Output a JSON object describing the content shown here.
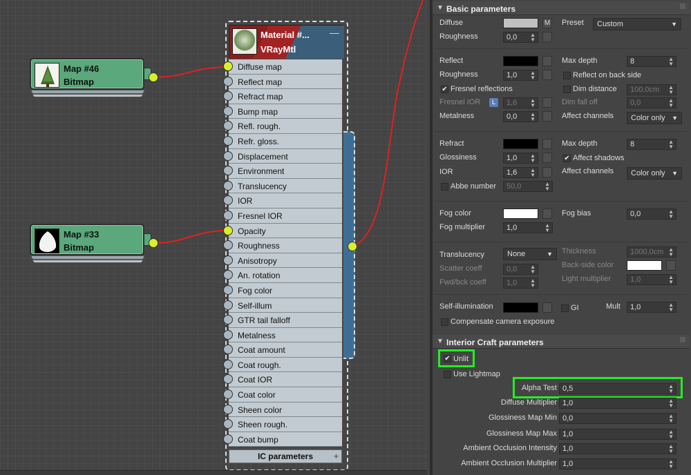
{
  "editor": {
    "map_nodes": [
      {
        "title": "Map #46",
        "type": "Bitmap"
      },
      {
        "title": "Map #33",
        "type": "Bitmap"
      }
    ],
    "material": {
      "title": "Material  #...",
      "type": "VRayMtl",
      "minimize": "—",
      "slots": [
        "Diffuse map",
        "Reflect map",
        "Refract map",
        "Bump map",
        "Refl. rough.",
        "Refr. gloss.",
        "Displacement",
        "Environment",
        "Translucency",
        "IOR",
        "Fresnel IOR",
        "Opacity",
        "Roughness",
        "Anisotropy",
        "An. rotation",
        "Fog color",
        "Self-illum",
        "GTR tail falloff",
        "Metalness",
        "Coat amount",
        "Coat rough.",
        "Coat IOR",
        "Coat color",
        "Sheen color",
        "Sheen rough.",
        "Coat bump"
      ],
      "connected_slots": [
        "Diffuse map",
        "Opacity"
      ],
      "footer": "IC parameters",
      "footer_plus": "+"
    },
    "wire_color": "#e02020",
    "socket_on_color": "#d8f02a"
  },
  "panel": {
    "basic": {
      "title": "Basic parameters",
      "diffuse": {
        "label": "Diffuse",
        "m_button": "M",
        "color": "#c0c0c0"
      },
      "preset": {
        "label": "Preset",
        "value": "Custom"
      },
      "roughness1": {
        "label": "Roughness",
        "value": "0,0"
      },
      "reflect": {
        "label": "Reflect",
        "color": "#000000"
      },
      "max_depth1": {
        "label": "Max depth",
        "value": "8"
      },
      "roughness2": {
        "label": "Roughness",
        "value": "1,0"
      },
      "reflect_back": {
        "label": "Reflect on back side",
        "checked": false
      },
      "fresnel": {
        "label": "Fresnel reflections",
        "checked": true
      },
      "dim_distance": {
        "label": "Dim distance",
        "value": "100,0cm",
        "checked": false
      },
      "fresnel_ior": {
        "label": "Fresnel IOR",
        "lock": "L",
        "value": "1,6"
      },
      "dim_falloff": {
        "label": "Dim fall off",
        "value": "0,0"
      },
      "metalness": {
        "label": "Metalness",
        "value": "0,0"
      },
      "affect_channels1": {
        "label": "Affect channels",
        "value": "Color only"
      },
      "refract": {
        "label": "Refract",
        "color": "#000000"
      },
      "max_depth2": {
        "label": "Max depth",
        "value": "8"
      },
      "glossiness": {
        "label": "Glossiness",
        "value": "1,0"
      },
      "affect_shadows": {
        "label": "Affect shadows",
        "checked": true
      },
      "ior": {
        "label": "IOR",
        "value": "1,6"
      },
      "affect_channels2": {
        "label": "Affect channels",
        "value": "Color only"
      },
      "abbe": {
        "label": "Abbe number",
        "value": "50,0",
        "checked": false
      },
      "fog_color": {
        "label": "Fog color",
        "color": "#ffffff"
      },
      "fog_bias": {
        "label": "Fog bias",
        "value": "0,0"
      },
      "fog_multiplier": {
        "label": "Fog multiplier",
        "value": "1,0"
      },
      "translucency": {
        "label": "Translucency",
        "value": "None"
      },
      "thickness": {
        "label": "Thickness",
        "value": "1000,0cm"
      },
      "scatter": {
        "label": "Scatter coeff",
        "value": "0,0"
      },
      "backside_color": {
        "label": "Back-side color",
        "color": "#ffffff"
      },
      "fwd_bck": {
        "label": "Fwd/bck coeff",
        "value": "1,0"
      },
      "light_mult": {
        "label": "Light multiplier",
        "value": "1,0"
      },
      "self_illum": {
        "label": "Self-illumination",
        "color": "#000000"
      },
      "gi": {
        "label": "GI",
        "checked": false
      },
      "mult": {
        "label": "Mult",
        "value": "1,0"
      },
      "compensate": {
        "label": "Compensate camera exposure",
        "checked": false
      }
    },
    "interior": {
      "title": "Interior Craft parameters",
      "unlit": {
        "label": "Unlit",
        "checked": true
      },
      "use_lightmap": {
        "label": "Use Lightmap",
        "checked": false
      },
      "rows": [
        {
          "label": "Alpha Test",
          "value": "0,5"
        },
        {
          "label": "Diffuse Multiplier",
          "value": "1,0"
        },
        {
          "label": "Glossiness Map Min",
          "value": "0,0"
        },
        {
          "label": "Glossiness Map Max",
          "value": "1,0"
        },
        {
          "label": "Ambient Occlusion Intensity",
          "value": "1,0"
        },
        {
          "label": "Ambient Occlusion Multiplier",
          "value": "1,0"
        }
      ]
    },
    "highlight_color": "#22ee22"
  }
}
